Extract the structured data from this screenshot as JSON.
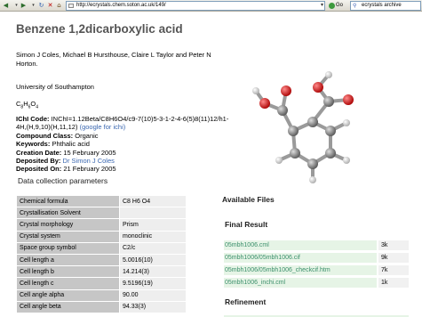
{
  "browser": {
    "url": "http://ecrystals.chem.soton.ac.uk/149/",
    "go_label": "Go",
    "search_label": "ecrystals archive"
  },
  "page": {
    "title": "Benzene 1,2dicarboxylic acid",
    "authors": "Simon J Coles, Michael B Hursthouse, Claire L Taylor and Peter N Horton.",
    "affiliation": "University of Southampton",
    "formula_c": "C",
    "formula_c_n": "8",
    "formula_h": "H",
    "formula_h_n": "6",
    "formula_o": "O",
    "formula_o_n": "4",
    "ichi_label": "IChI Code:",
    "ichi_value": "INChI=1.12Beta/C8H6O4/c9-7(10)5-3-1-2-4-6(5)8(11)12/h1-4H,(H,9,10)(H,11,12)",
    "ichi_link": "(google for ichi)",
    "compound_class_label": "Compound Class:",
    "compound_class": "Organic",
    "keywords_label": "Keywords:",
    "keywords": "Phthalic acid",
    "creation_date_label": "Creation Date:",
    "creation_date": "15 February 2005",
    "deposited_by_label": "Deposited By:",
    "deposited_by": "Dr Simon J Coles",
    "deposited_on_label": "Deposited On:",
    "deposited_on": "21 February 2005"
  },
  "data_collection": {
    "heading": "Data collection parameters",
    "rows": [
      {
        "key": "Chemical formula",
        "value": "C8 H6 O4"
      },
      {
        "key": "Crystallisation Solvent",
        "value": ""
      },
      {
        "key": "Crystal morphology",
        "value": "Prism"
      },
      {
        "key": "Crystal system",
        "value": "monoclinic"
      },
      {
        "key": "Space group symbol",
        "value": "C2/c"
      },
      {
        "key": "Cell length a",
        "value": "5.0016(10)"
      },
      {
        "key": "Cell length b",
        "value": "14.214(3)"
      },
      {
        "key": "Cell length c",
        "value": "9.5196(19)"
      },
      {
        "key": "Cell angle alpha",
        "value": "90.00"
      },
      {
        "key": "Cell angle beta",
        "value": "94.33(3)"
      }
    ]
  },
  "files": {
    "heading": "Available Files",
    "final_result_heading": "Final Result",
    "items": [
      {
        "name": "05mbh1006.cml",
        "size": "3k"
      },
      {
        "name": "05mbh1006/05mbh1006.cif",
        "size": "9k"
      },
      {
        "name": "05mbh1006/05mbh1006_checkcif.htm",
        "size": "7k"
      },
      {
        "name": "05mbh1006_inchi.cml",
        "size": "1k"
      }
    ],
    "refinement_heading": "Refinement"
  },
  "colors": {
    "link": "#3a67b0",
    "file_link": "#3a8f6a",
    "table_key_bg": "#c6c6c6",
    "file_row_bg": "#e6f4e6"
  },
  "icons": [
    "back-icon",
    "forward-icon",
    "reload-icon",
    "stop-icon",
    "home-icon",
    "page-icon",
    "go-icon",
    "search-icon"
  ]
}
